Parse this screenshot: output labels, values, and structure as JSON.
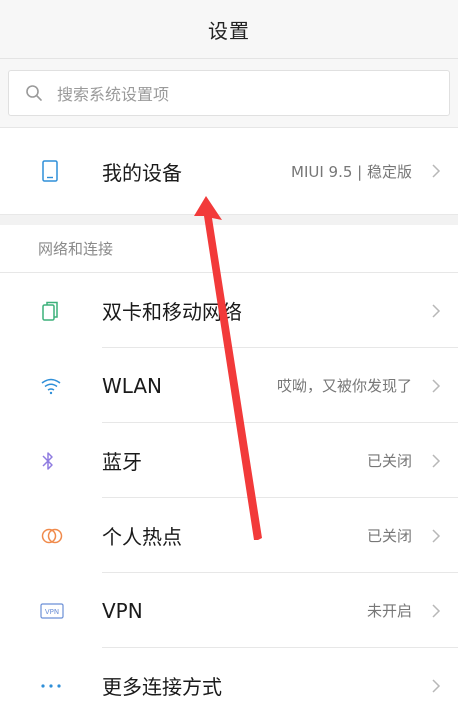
{
  "header": {
    "title": "设置"
  },
  "search": {
    "placeholder": "搜索系统设置项"
  },
  "device": {
    "label": "我的设备",
    "value": "MIUI 9.5 | 稳定版"
  },
  "section": {
    "title": "网络和连接"
  },
  "items": [
    {
      "label": "双卡和移动网络",
      "value": "",
      "icon": "sim-card-icon"
    },
    {
      "label": "WLAN",
      "value": "哎呦，又被你发现了",
      "icon": "wifi-icon"
    },
    {
      "label": "蓝牙",
      "value": "已关闭",
      "icon": "bluetooth-icon"
    },
    {
      "label": "个人热点",
      "value": "已关闭",
      "icon": "hotspot-icon"
    },
    {
      "label": "VPN",
      "value": "未开启",
      "icon": "vpn-icon"
    },
    {
      "label": "更多连接方式",
      "value": "",
      "icon": "more-dots-icon"
    }
  ],
  "colors": {
    "accent_blue": "#2f8fd8",
    "hotspot_orange": "#f08a4b",
    "bluetooth_purple": "#8f7ce0",
    "annotation_red": "#f23a3a"
  }
}
